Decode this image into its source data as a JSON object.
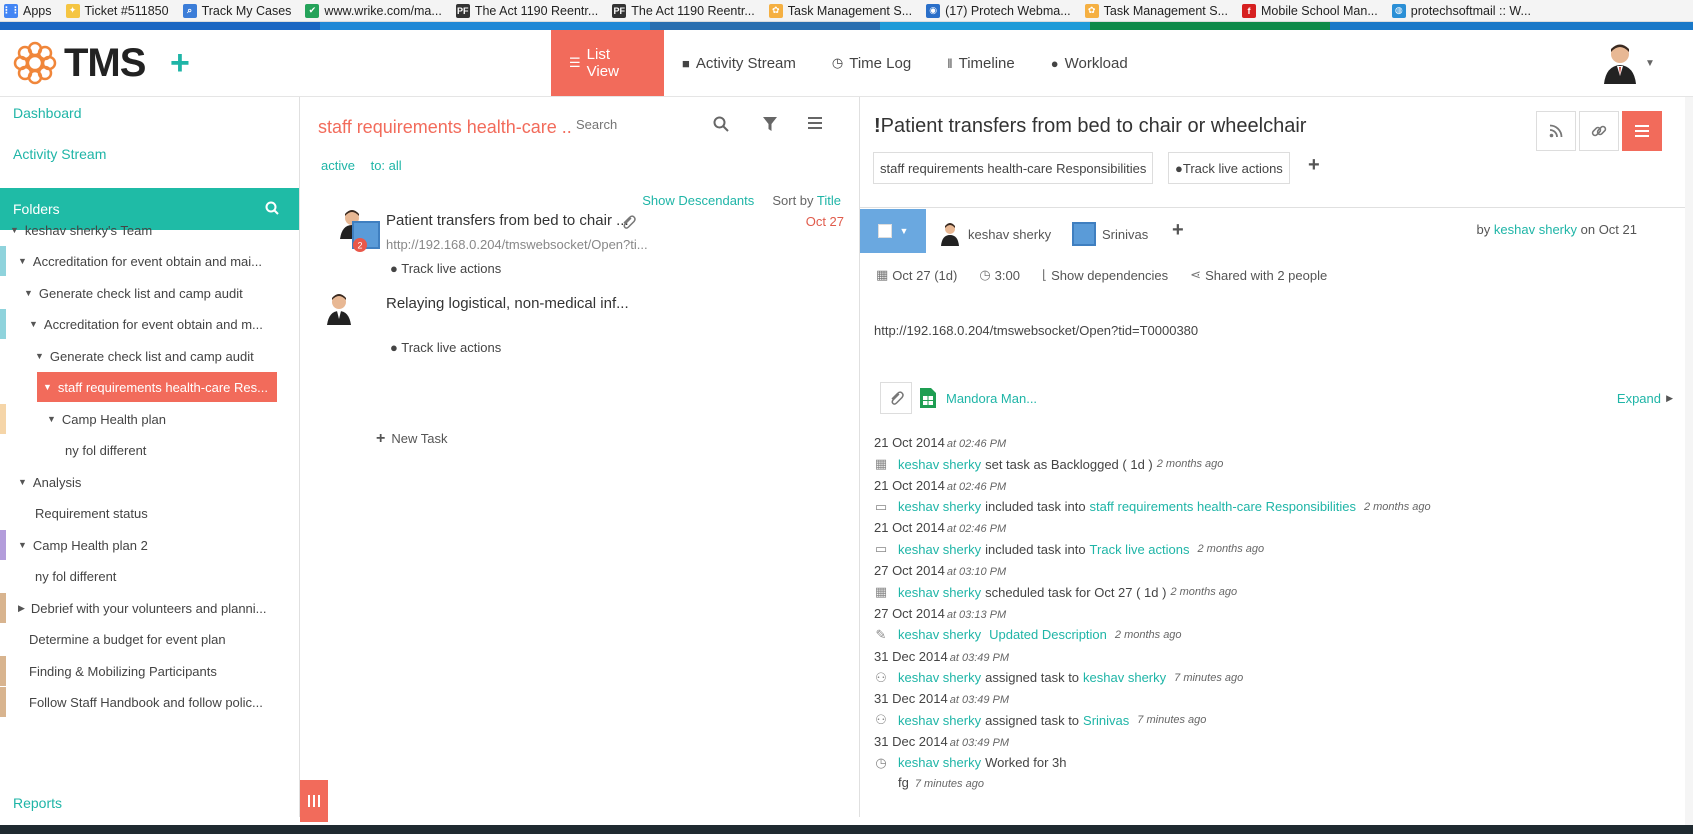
{
  "bookmarks": [
    {
      "label": "Apps",
      "icon": "apps-grid-icon",
      "color": "#4285f4"
    },
    {
      "label": "Ticket #511850",
      "icon": "ticket-icon",
      "color": "#f5c542"
    },
    {
      "label": "Track My Cases",
      "icon": "magnifier-icon",
      "color": "#3b7dd8"
    },
    {
      "label": "www.wrike.com/ma...",
      "icon": "check-icon",
      "color": "#25a35a"
    },
    {
      "label": "The Act 1190 Reentr...",
      "icon": "pf-icon",
      "color": "#333333"
    },
    {
      "label": "The Act 1190 Reentr...",
      "icon": "pf-icon",
      "color": "#333333"
    },
    {
      "label": "Task Management S...",
      "icon": "tms-icon",
      "color": "#f5b042"
    },
    {
      "label": "(17) Protech Webma...",
      "icon": "mail-icon",
      "color": "#2a6fc9"
    },
    {
      "label": "Task Management S...",
      "icon": "tms-icon",
      "color": "#f5b042"
    },
    {
      "label": "Mobile School Man...",
      "icon": "f-icon",
      "color": "#d62020"
    },
    {
      "label": "protechsoftmail :: W...",
      "icon": "globe-icon",
      "color": "#2a8fd6"
    }
  ],
  "header": {
    "logo_text": "TMS",
    "nav": [
      {
        "label": "List View",
        "icon": "list-icon",
        "active": true
      },
      {
        "label": "Activity Stream",
        "icon": "comment-icon",
        "active": false
      },
      {
        "label": "Time Log",
        "icon": "clock-icon",
        "active": false
      },
      {
        "label": "Timeline",
        "icon": "timeline-icon",
        "active": false
      },
      {
        "label": "Workload",
        "icon": "user-icon",
        "active": false
      }
    ]
  },
  "sidebar": {
    "dashboard": "Dashboard",
    "activity_stream": "Activity Stream",
    "folders": "Folders",
    "tree": [
      {
        "label": "keshav sherky's Team",
        "caret": "▼"
      },
      {
        "label": "Accreditation for event obtain and mai...",
        "caret": "▼"
      },
      {
        "label": "Generate check list and camp audit",
        "caret": "▼"
      },
      {
        "label": "Accreditation for event obtain and m...",
        "caret": "▼"
      },
      {
        "label": "Generate check list and camp audit",
        "caret": "▼"
      },
      {
        "label": "staff requirements health-care Res...",
        "caret": "▼"
      },
      {
        "label": "Camp Health plan",
        "caret": "▼"
      },
      {
        "label": "ny fol different",
        "caret": ""
      },
      {
        "label": "Analysis",
        "caret": "▼"
      },
      {
        "label": "Requirement status",
        "caret": ""
      },
      {
        "label": "Camp Health plan 2",
        "caret": "▼"
      },
      {
        "label": "ny fol different",
        "caret": ""
      },
      {
        "label": "Debrief with your volunteers and planni...",
        "caret": "▶"
      },
      {
        "label": "Determine a budget for event plan",
        "caret": ""
      },
      {
        "label": "Finding & Mobilizing Participants",
        "caret": ""
      },
      {
        "label": "Follow Staff Handbook and follow polic...",
        "caret": ""
      }
    ],
    "reports": "Reports"
  },
  "list": {
    "title": "staff requirements health-care ..",
    "search_placeholder": "Search",
    "filter_active": "active",
    "filter_to": "to: all",
    "show_descendants": "Show Descendants",
    "sort_by": "Sort by",
    "sort_field": "Title",
    "tasks": [
      {
        "title": "Patient transfers from bed to chair ...",
        "url": "http://192.168.0.204/tmswebsocket/Open?ti...",
        "folder": "Track live actions",
        "date": "Oct 27",
        "badge": "2"
      },
      {
        "title": "Relaying logistical, non-medical inf...",
        "url": "",
        "folder": "Track live actions",
        "date": "",
        "badge": ""
      }
    ],
    "new_task": "New Task"
  },
  "detail": {
    "title": "Patient transfers from bed to chair or wheelchair",
    "tag_folder": "staff requirements health-care Responsibilities",
    "tag_project": "Track live actions",
    "assignee1": "keshav sherky",
    "assignee2": "Srinivas",
    "by_prefix": "by",
    "by_user": "keshav sherky",
    "by_suffix": "on Oct 21",
    "meta_date": "Oct 27 (1d)",
    "meta_time": "3:00",
    "meta_deps": "Show dependencies",
    "meta_shared": "Shared with 2 people",
    "description_url": "http://192.168.0.204/tmswebsocket/Open?tid=T0000380",
    "attachment_name": "Mandora Man...",
    "expand": "Expand",
    "activity": [
      {
        "date": "21 Oct 2014",
        "time": "at 02:46 PM",
        "icon": "calendar-icon",
        "who": "keshav sherky",
        "action": "set task as Backlogged ( 1d )",
        "target": "",
        "after": "",
        "ago": "2 months ago"
      },
      {
        "date": "21 Oct 2014",
        "time": "at 02:46 PM",
        "icon": "folder-icon",
        "who": "keshav sherky",
        "action": "included task into",
        "target": "staff requirements health-care Responsibilities",
        "after": "",
        "ago": "2 months ago"
      },
      {
        "date": "21 Oct 2014",
        "time": "at 02:46 PM",
        "icon": "folder-icon",
        "who": "keshav sherky",
        "action": "included task into",
        "target": "Track live actions",
        "after": "",
        "ago": "2 months ago"
      },
      {
        "date": "27 Oct 2014",
        "time": "at 03:10 PM",
        "icon": "calendar-icon",
        "who": "keshav sherky",
        "action": "scheduled task for Oct 27 ( 1d )",
        "target": "",
        "after": "",
        "ago": "2 months ago"
      },
      {
        "date": "27 Oct 2014",
        "time": "at 03:13 PM",
        "icon": "pencil-icon",
        "who": "keshav sherky",
        "action": "",
        "target": "Updated Description",
        "after": "",
        "ago": "2 months ago"
      },
      {
        "date": "31 Dec 2014",
        "time": "at 03:49 PM",
        "icon": "assign-icon",
        "who": "keshav sherky",
        "action": "assigned task to",
        "target": "keshav sherky",
        "after": "",
        "ago": "7 minutes ago"
      },
      {
        "date": "31 Dec 2014",
        "time": "at 03:49 PM",
        "icon": "assign-icon",
        "who": "keshav sherky",
        "action": "assigned task to",
        "target": "Srinivas",
        "after": "",
        "ago": "7 minutes ago"
      },
      {
        "date": "31 Dec 2014",
        "time": "at 03:49 PM",
        "icon": "clock-icon",
        "who": "keshav sherky",
        "action": "Worked for 3h",
        "target": "",
        "after": "fg",
        "ago": "7 minutes ago"
      }
    ]
  },
  "colors": {
    "accent": "#f26b5b",
    "teal": "#1fb5a7",
    "folders_bar": "#1fbba6",
    "status_blue": "#6aa8e0"
  }
}
